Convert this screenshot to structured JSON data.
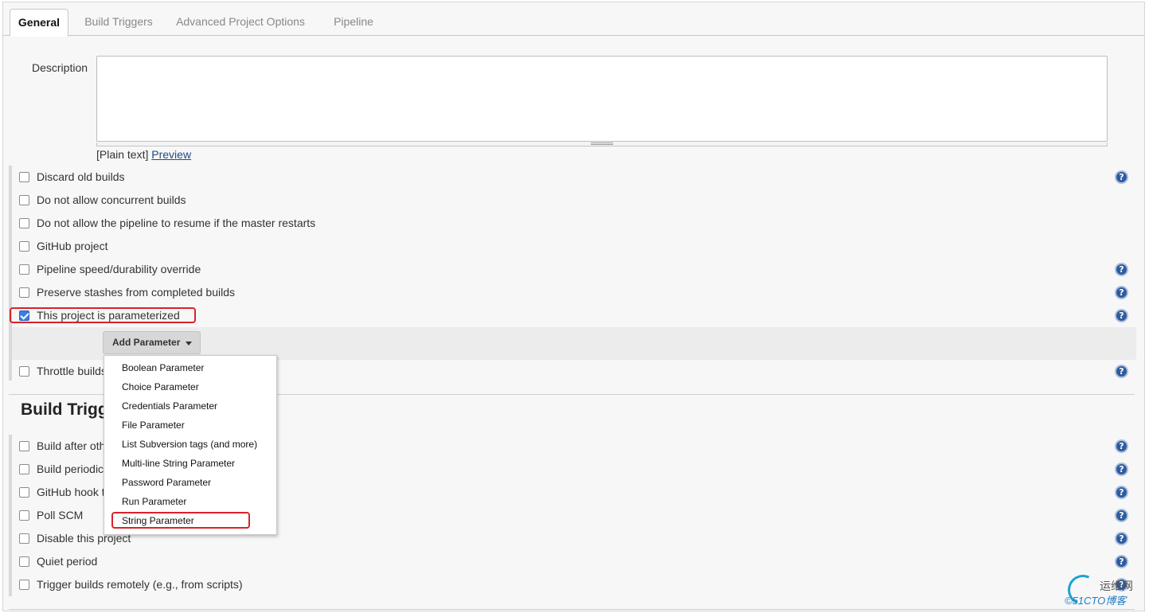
{
  "tabs": [
    "General",
    "Build Triggers",
    "Advanced Project Options",
    "Pipeline"
  ],
  "description": {
    "label": "Description",
    "value": "",
    "format_prefix": "[Plain text]",
    "preview_link": "Preview"
  },
  "general_options": [
    {
      "label": "Discard old builds",
      "checked": false,
      "help": true
    },
    {
      "label": "Do not allow concurrent builds",
      "checked": false,
      "help": false
    },
    {
      "label": "Do not allow the pipeline to resume if the master restarts",
      "checked": false,
      "help": false
    },
    {
      "label": "GitHub project",
      "checked": false,
      "help": false
    },
    {
      "label": "Pipeline speed/durability override",
      "checked": false,
      "help": true
    },
    {
      "label": "Preserve stashes from completed builds",
      "checked": false,
      "help": true
    },
    {
      "label": "This project is parameterized",
      "checked": true,
      "help": true
    },
    {
      "label": "Throttle builds",
      "checked": false,
      "help": true
    }
  ],
  "add_parameter": {
    "label": "Add Parameter",
    "menu_items": [
      "Boolean Parameter",
      "Choice Parameter",
      "Credentials Parameter",
      "File Parameter",
      "List Subversion tags (and more)",
      "Multi-line String Parameter",
      "Password Parameter",
      "Run Parameter",
      "String Parameter"
    ],
    "highlighted_item": "String Parameter"
  },
  "build_triggers": {
    "heading": "Build Trigg",
    "options": [
      {
        "label": "Build after oth",
        "checked": false,
        "help": true
      },
      {
        "label": "Build periodica",
        "checked": false,
        "help": true
      },
      {
        "label": "GitHub hook t",
        "checked": false,
        "help": true
      },
      {
        "label": "Poll SCM",
        "checked": false,
        "help": true
      },
      {
        "label": "Disable this project",
        "checked": false,
        "help": true
      },
      {
        "label": "Quiet period",
        "checked": false,
        "help": true
      },
      {
        "label": "Trigger builds remotely (e.g., from scripts)",
        "checked": false,
        "help": true
      }
    ]
  },
  "watermark": {
    "line1": "运维网",
    "line2": "©51CTO博客"
  },
  "colors": {
    "highlight": "#d8232a",
    "checkbox_checked": "#3b7de1",
    "help_icon": "#2f5c9e"
  }
}
